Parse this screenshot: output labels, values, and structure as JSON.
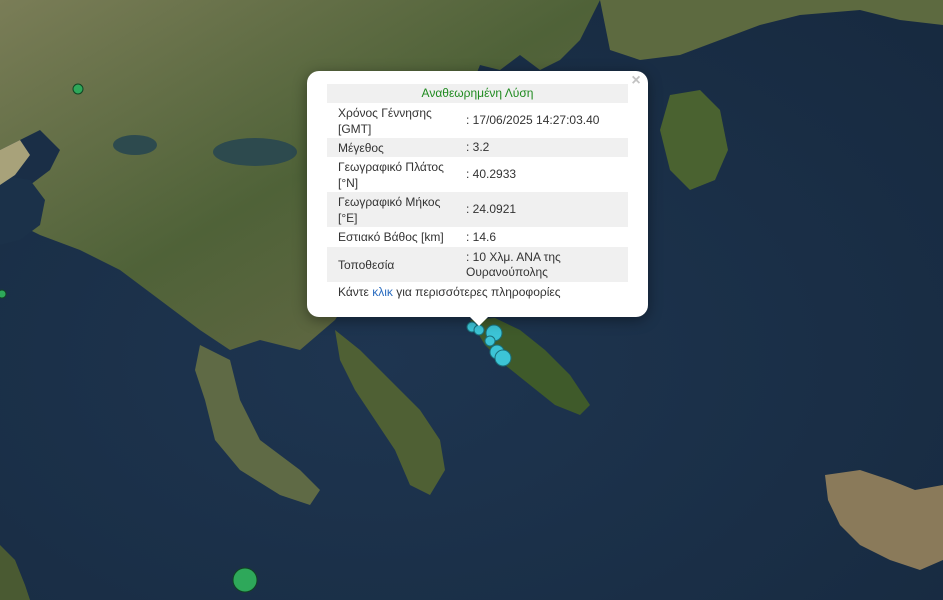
{
  "popup": {
    "title": "Αναθεωρημένη Λύση",
    "close_glyph": "×",
    "rows": [
      {
        "label": "Χρόνος Γέννησης [GMT]",
        "value": ": 17/06/2025 14:27:03.40"
      },
      {
        "label": "Μέγεθος",
        "value": ": 3.2"
      },
      {
        "label": "Γεωγραφικό Πλάτος [°N]",
        "value": ": 40.2933"
      },
      {
        "label": "Γεωγραφικό Μήκος [°E]",
        "value": ": 24.0921"
      },
      {
        "label": "Εστιακό Βάθος [km]",
        "value": ": 14.6"
      },
      {
        "label": "Τοποθεσία",
        "value": ": 10 Χλμ. ΑΝΑ της Ουρανούπολης"
      }
    ],
    "footer_prefix": "Κάντε ",
    "footer_link": "κλικ",
    "footer_suffix": " για περισσότερες πληροφορίες"
  },
  "colors": {
    "sea": "#1c3148",
    "land": "#5a6a3f",
    "marker_cyan": "#3cc4d6",
    "marker_green": "#2ea85a",
    "title_green": "#1f8a1f",
    "link_blue": "#2a6cc0"
  }
}
